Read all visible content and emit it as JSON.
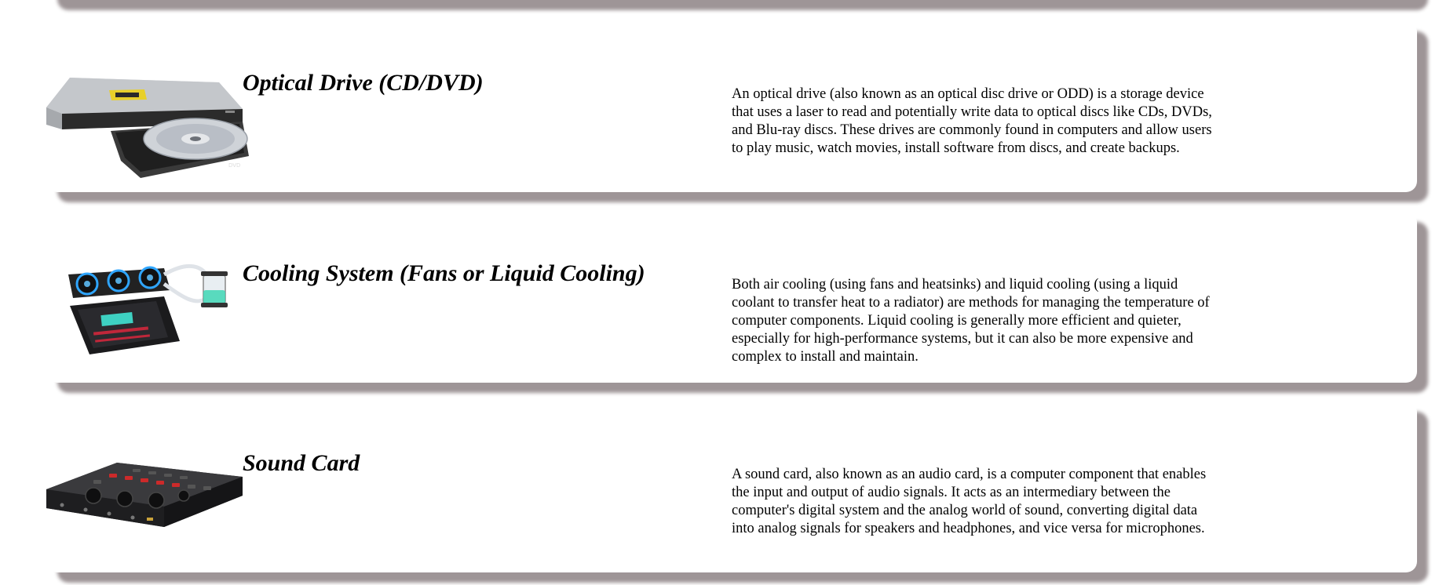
{
  "components": [
    {
      "title": "Optical Drive (CD/DVD)",
      "image_icon": "optical-drive-image",
      "description": "An optical drive (also known as an optical disc drive or ODD) is a storage device that uses a laser to read and potentially write data to optical discs like CDs, DVDs, and Blu-ray discs. These drives are commonly found in computers and allow users to play music, watch movies, install software from discs, and create backups."
    },
    {
      "title": "Cooling System (Fans or Liquid Cooling)",
      "image_icon": "liquid-cooling-image",
      "description": "Both air cooling (using fans and heatsinks) and liquid cooling (using a liquid coolant to transfer heat to a radiator) are methods for managing the temperature of computer components. Liquid cooling is generally more efficient and quieter, especially for high-performance systems, but it can also be more expensive and complex to install and maintain."
    },
    {
      "title": "Sound Card",
      "image_icon": "sound-card-image",
      "description": "A sound card, also known as an audio card, is a computer component that enables the input and output of audio signals. It acts as an intermediary between the computer's digital system and the analog world of sound, converting digital data into analog signals for speakers and headphones, and vice versa for microphones."
    }
  ]
}
